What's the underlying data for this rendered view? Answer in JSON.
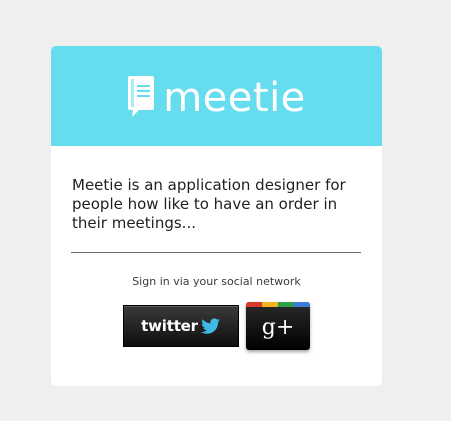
{
  "brand": {
    "name": "meetie",
    "header_color": "#66dcef"
  },
  "content": {
    "tagline": "Meetie is an application designer for people how like to have an order in their meetings...",
    "signin_prompt": "Sign in via your social network"
  },
  "social": {
    "twitter": {
      "label": "twitter",
      "icon": "twitter-bird-icon",
      "bird_color": "#3fb8e6"
    },
    "gplus": {
      "label": "g+",
      "icon": "google-plus-icon",
      "stripe_colors": [
        "#d7392b",
        "#f2b320",
        "#2f9e4a",
        "#3b7ad9"
      ]
    }
  }
}
